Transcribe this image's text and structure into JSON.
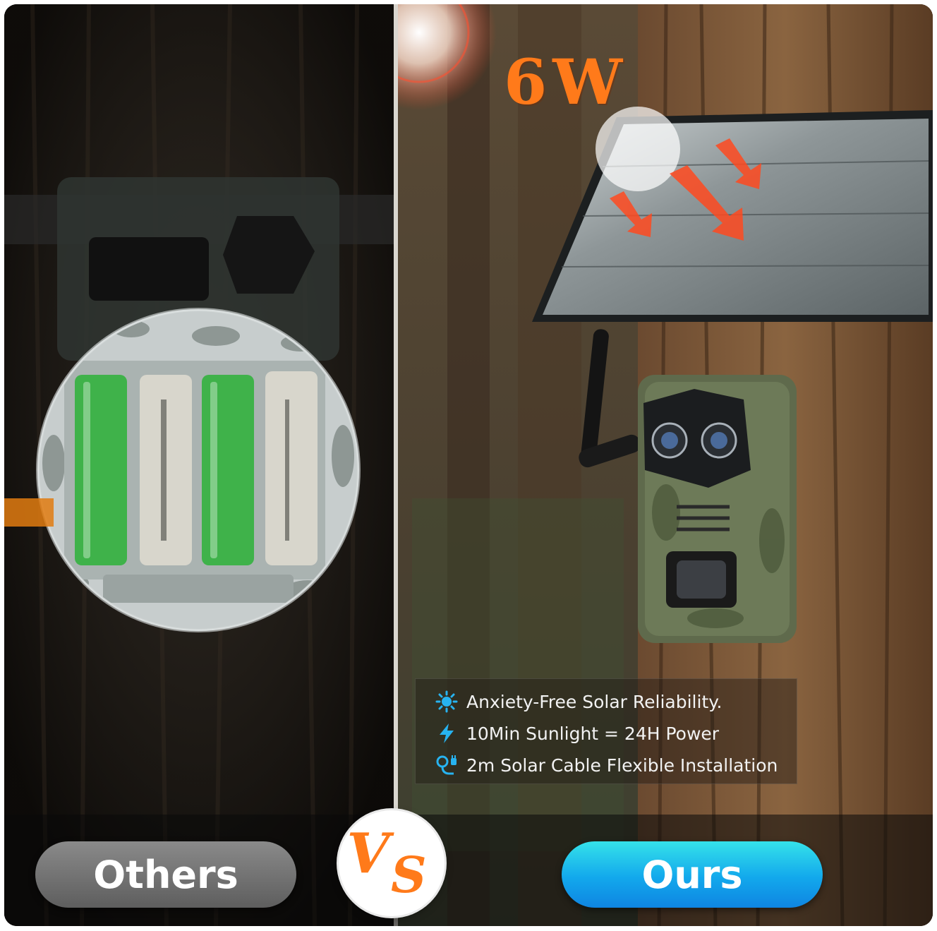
{
  "left_panel": {
    "label": "Others"
  },
  "right_panel": {
    "label": "Ours",
    "power_label": "6W",
    "features": [
      {
        "icon": "sun-icon",
        "text": "Anxiety-Free Solar Reliability."
      },
      {
        "icon": "lightning-icon",
        "text": "10Min Sunlight = 24H Power"
      },
      {
        "icon": "plug-icon",
        "text": "2m Solar Cable Flexible Installation"
      }
    ]
  },
  "vs_badge": {
    "v": "V",
    "s": "S"
  },
  "colors": {
    "accent_orange": "#ff7a1a",
    "ours_blue": "#12a8ec",
    "ours_cyan": "#35e2ea",
    "others_gray": "#6e6e6e",
    "feature_icon_blue": "#27b3f0",
    "battery_green": "#3fb24a",
    "battery_white": "#d8d6cc"
  }
}
